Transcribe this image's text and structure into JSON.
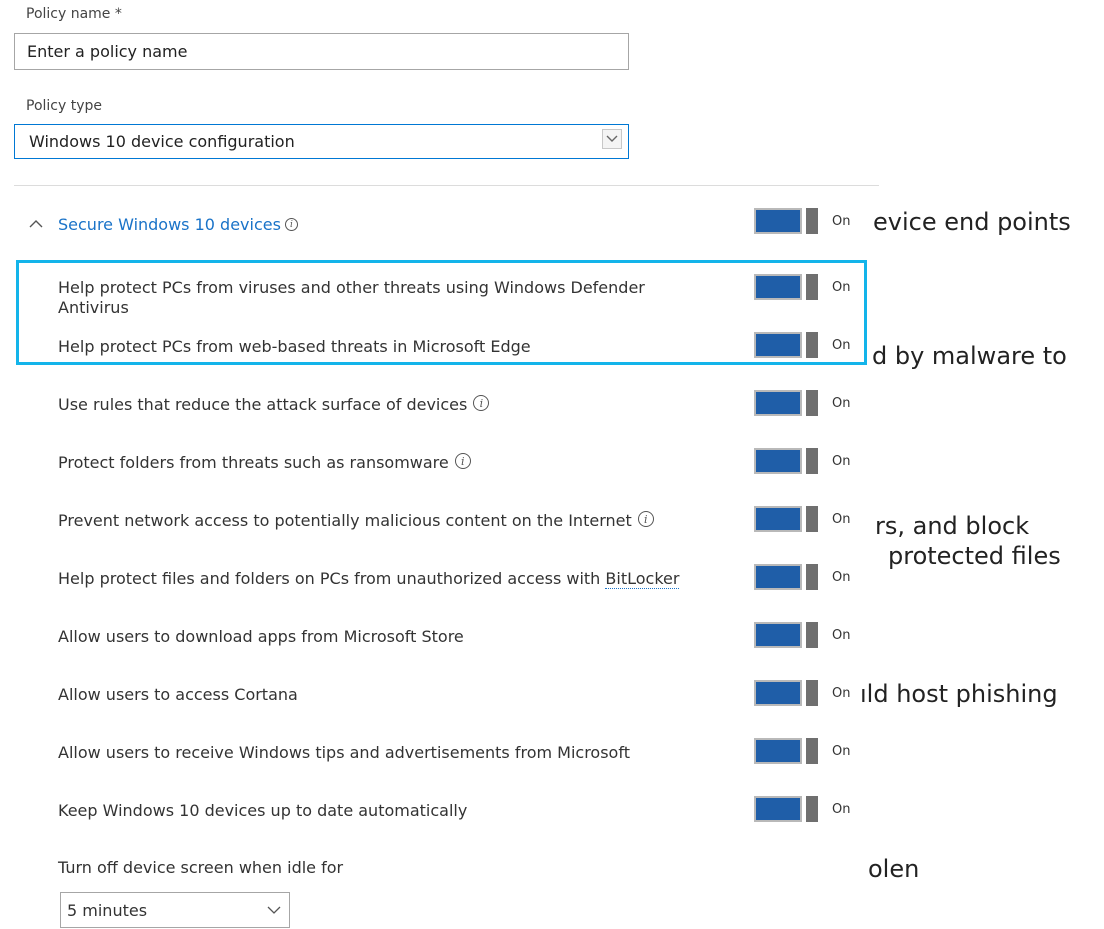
{
  "background_text": [
    "evice end points",
    "d by malware to",
    "rs, and block",
    "protected files",
    "ıld host phishing",
    "olen"
  ],
  "policy_name": {
    "label": "Policy name *",
    "value": "Enter a policy name"
  },
  "policy_type": {
    "label": "Policy type",
    "selected": "Windows 10 device configuration"
  },
  "section": {
    "title": "Secure Windows 10 devices",
    "state": "On"
  },
  "settings": [
    {
      "label": "Help protect PCs from viruses and other threats using Windows Defender Antivirus",
      "state": "On"
    },
    {
      "label": "Help protect PCs from web-based threats in Microsoft Edge",
      "state": "On"
    },
    {
      "label": "Use rules that reduce the attack surface of devices",
      "state": "On"
    },
    {
      "label": "Protect folders from threats such as ransomware",
      "state": "On"
    },
    {
      "label": "Prevent network access to potentially malicious content on the Internet",
      "state": "On"
    },
    {
      "label_prefix": "Help protect files and folders on PCs from unauthorized access with ",
      "link": "BitLocker",
      "state": "On"
    },
    {
      "label": "Allow users to download apps from Microsoft Store",
      "state": "On"
    },
    {
      "label": "Allow users to access Cortana",
      "state": "On"
    },
    {
      "label": "Allow users to receive Windows tips and advertisements from Microsoft",
      "state": "On"
    },
    {
      "label": "Keep Windows 10 devices up to date automatically",
      "state": "On"
    }
  ],
  "screen_idle": {
    "label": "Turn off device screen when idle for",
    "selected": "5 minutes"
  },
  "colors": {
    "accent": "#1a73c8",
    "toggle_on": "#1f5ea8",
    "highlight": "#13b4ea"
  }
}
